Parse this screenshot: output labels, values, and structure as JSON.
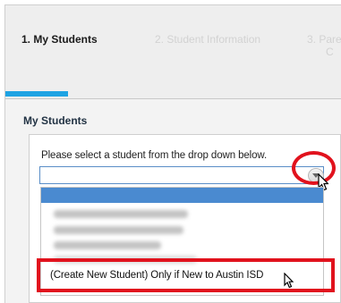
{
  "wizard": {
    "steps": [
      {
        "label": "1. My Students"
      },
      {
        "label": "2. Student Information"
      },
      {
        "label": "3. Pare"
      }
    ],
    "step3_continuation": "C",
    "progress_fraction": 0.33
  },
  "section": {
    "title": "My Students",
    "prompt": "Please select a student from the drop down below.",
    "select": {
      "value": "",
      "button_icon": "chevron-down-icon"
    },
    "dropdown": {
      "create_option": "(Create New Student) Only if New to Austin ISD"
    }
  },
  "colors": {
    "accent": "#1ea3e3",
    "annotation_red": "#e1121d",
    "highlight": "#4a8ad0"
  }
}
